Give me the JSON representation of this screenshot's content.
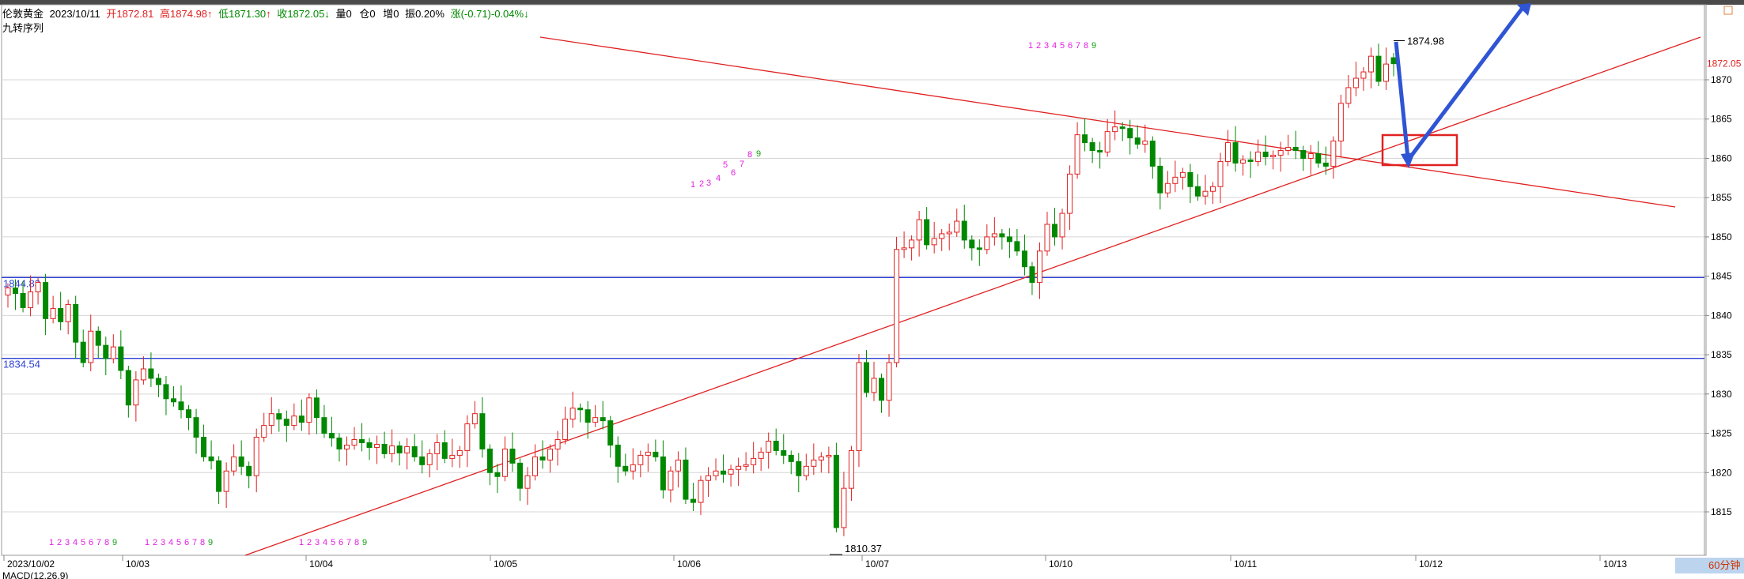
{
  "header": {
    "symbol": "伦敦黄金",
    "date": "2023/10/11",
    "open_label": "开",
    "open_value": "1872.81",
    "high_label": "高",
    "high_value": "1874.98",
    "low_label": "低",
    "low_value": "1871.30",
    "close_label": "收",
    "close_value": "1872.05",
    "vol_label": "量",
    "vol_value": "0",
    "oi_label": "仓",
    "oi_value": "0",
    "inc_label": "增",
    "inc_value": "0",
    "amp_label": "振",
    "amp_value": "0.20%",
    "chg_label": "涨",
    "chg_value": "(-0.71)-0.04%",
    "indicator": "九转序列"
  },
  "period_label": "60分钟",
  "macd_label": "MACD(12,26,9)",
  "colors": {
    "up": "#e02020",
    "down": "#008800",
    "price_line": "#2b3fd6",
    "trend": "#e02020",
    "arrow": "#2f55d4",
    "seq_magenta": "#e020e0",
    "seq_green": "#14a014"
  },
  "chart_data": {
    "type": "candlestick",
    "ylim": [
      1808,
      1878
    ],
    "y_ticks": [
      1815,
      1820,
      1825,
      1830,
      1835,
      1840,
      1845,
      1850,
      1855,
      1860,
      1865,
      1870
    ],
    "x_ticks": [
      "2023/10/02",
      "10/03",
      "10/04",
      "10/05",
      "10/06",
      "10/07",
      "10/10",
      "10/11",
      "10/12",
      "10/13"
    ],
    "current_price": "1872.05",
    "h_lines": [
      {
        "label": "1844.83",
        "value": 1844.83
      },
      {
        "label": "1834.54",
        "value": 1834.54
      }
    ],
    "annotations": [
      {
        "text": "1874.98",
        "value": 1874.98
      },
      {
        "text": "1810.37",
        "value": 1810.37
      }
    ],
    "seq_labels": [
      "1",
      "2",
      "3",
      "4",
      "5",
      "6",
      "7",
      "8",
      "9"
    ],
    "candles_close": [
      1843.5,
      1842.8,
      1841.0,
      1843.0,
      1844.2,
      1839.6,
      1840.9,
      1839.2,
      1841.4,
      1836.6,
      1834.0,
      1838.0,
      1836.2,
      1834.5,
      1836.0,
      1833.0,
      1828.6,
      1831.8,
      1833.2,
      1832.0,
      1831.2,
      1829.4,
      1829.0,
      1828.0,
      1827.0,
      1824.5,
      1822.0,
      1821.5,
      1817.6,
      1820.2,
      1822.0,
      1820.8,
      1819.6,
      1824.5,
      1826.0,
      1827.5,
      1826.8,
      1826.0,
      1827.2,
      1826.4,
      1829.5,
      1827.0,
      1825.0,
      1824.4,
      1823.0,
      1823.5,
      1824.2,
      1823.8,
      1823.2,
      1823.6,
      1822.4,
      1823.4,
      1822.5,
      1823.3,
      1822.0,
      1821.0,
      1822.4,
      1823.8,
      1821.8,
      1822.2,
      1822.8,
      1826.2,
      1827.5,
      1823.0,
      1820.0,
      1819.5,
      1823.0,
      1821.2,
      1818.0,
      1819.6,
      1822.0,
      1821.6,
      1823.0,
      1824.2,
      1826.8,
      1828.2,
      1828.0,
      1826.4,
      1827.0,
      1826.6,
      1823.5,
      1820.8,
      1820.2,
      1821.0,
      1822.2,
      1822.6,
      1822.0,
      1817.8,
      1820.2,
      1821.6,
      1816.6,
      1816.2,
      1819.0,
      1819.6,
      1820.2,
      1819.8,
      1820.4,
      1820.8,
      1821.0,
      1821.8,
      1822.6,
      1824.0,
      1822.8,
      1822.2,
      1821.4,
      1819.6,
      1820.8,
      1821.6,
      1822.0,
      1822.2,
      1813.0,
      1818.0,
      1822.8,
      1834.0,
      1830.2,
      1832.0,
      1829.2,
      1834.0,
      1848.4,
      1848.6,
      1849.6,
      1852.2,
      1849.0,
      1849.8,
      1850.4,
      1850.6,
      1852.0,
      1849.6,
      1848.6,
      1848.4,
      1850.0,
      1850.4,
      1850.0,
      1849.4,
      1848.2,
      1846.2,
      1844.2,
      1848.2,
      1851.6,
      1850.0,
      1853.0,
      1858.0,
      1863.0,
      1862.0,
      1861.0,
      1860.8,
      1863.4,
      1864.0,
      1863.8,
      1862.6,
      1861.8,
      1862.2,
      1859.0,
      1855.6,
      1856.8,
      1857.6,
      1858.2,
      1856.4,
      1855.2,
      1855.8,
      1856.4,
      1859.6,
      1862.0,
      1859.4,
      1859.8,
      1859.6,
      1860.8,
      1860.2,
      1860.4,
      1861.0,
      1861.4,
      1861.0,
      1860.0,
      1860.6,
      1859.4,
      1859.0,
      1862.2,
      1867.0,
      1869.0,
      1870.2,
      1871.0,
      1873.0,
      1869.8,
      1872.0,
      1872.05
    ],
    "candles_open": [
      1842.6,
      1843.5,
      1842.8,
      1841.0,
      1843.0,
      1844.2,
      1839.6,
      1840.9,
      1839.2,
      1841.4,
      1836.6,
      1834.0,
      1838.0,
      1836.2,
      1834.5,
      1836.0,
      1833.0,
      1828.6,
      1831.8,
      1833.2,
      1832.0,
      1831.2,
      1829.4,
      1829.0,
      1828.0,
      1827.0,
      1824.5,
      1822.0,
      1821.5,
      1817.6,
      1820.2,
      1822.0,
      1820.8,
      1819.6,
      1824.5,
      1826.0,
      1827.5,
      1826.8,
      1826.0,
      1827.2,
      1826.4,
      1829.5,
      1827.0,
      1825.0,
      1824.4,
      1823.0,
      1823.5,
      1824.2,
      1823.8,
      1823.2,
      1823.6,
      1822.4,
      1823.4,
      1822.5,
      1823.3,
      1822.0,
      1821.0,
      1822.4,
      1823.8,
      1821.8,
      1822.2,
      1822.8,
      1826.2,
      1827.5,
      1823.0,
      1820.0,
      1819.5,
      1823.0,
      1821.2,
      1818.0,
      1819.6,
      1822.0,
      1821.6,
      1823.0,
      1824.2,
      1826.8,
      1828.2,
      1828.0,
      1826.4,
      1827.0,
      1826.6,
      1823.5,
      1820.8,
      1820.2,
      1821.0,
      1822.2,
      1822.6,
      1822.0,
      1817.8,
      1820.2,
      1821.6,
      1816.6,
      1816.2,
      1819.0,
      1819.6,
      1820.2,
      1819.8,
      1820.4,
      1820.8,
      1821.0,
      1821.8,
      1822.6,
      1824.0,
      1822.8,
      1822.2,
      1821.4,
      1819.6,
      1820.8,
      1821.6,
      1822.0,
      1822.2,
      1813.0,
      1818.0,
      1822.8,
      1834.0,
      1830.2,
      1832.0,
      1829.2,
      1834.0,
      1848.4,
      1848.6,
      1849.6,
      1852.2,
      1849.0,
      1849.8,
      1850.4,
      1850.6,
      1852.0,
      1849.6,
      1848.6,
      1848.4,
      1850.0,
      1850.4,
      1850.0,
      1849.4,
      1848.2,
      1846.2,
      1844.2,
      1848.2,
      1851.6,
      1850.0,
      1853.0,
      1858.0,
      1863.0,
      1862.0,
      1861.0,
      1860.8,
      1863.4,
      1864.0,
      1863.8,
      1862.6,
      1861.8,
      1862.2,
      1859.0,
      1855.6,
      1856.8,
      1857.6,
      1858.2,
      1856.4,
      1855.2,
      1855.8,
      1856.4,
      1859.6,
      1862.0,
      1859.4,
      1859.8,
      1859.6,
      1860.8,
      1860.2,
      1860.4,
      1861.0,
      1861.4,
      1861.0,
      1860.0,
      1860.6,
      1859.4,
      1859.0,
      1862.2,
      1867.0,
      1869.0,
      1870.2,
      1871.0,
      1873.0,
      1869.8,
      1872.81
    ]
  }
}
